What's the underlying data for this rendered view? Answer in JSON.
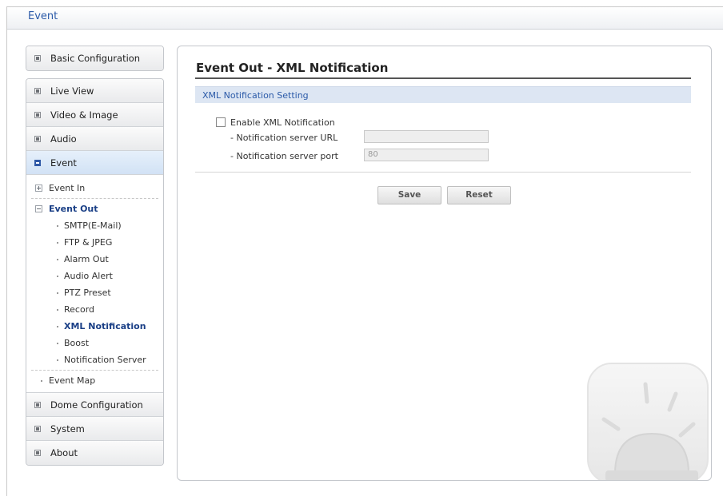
{
  "window": {
    "title": "Event"
  },
  "sidebar": {
    "top_items": [
      {
        "label": "Basic Configuration"
      }
    ],
    "main_items": [
      {
        "label": "Live View"
      },
      {
        "label": "Video & Image"
      },
      {
        "label": "Audio"
      },
      {
        "label": "Event",
        "active": true
      }
    ],
    "event_tree": {
      "event_in": "Event In",
      "event_out": "Event Out",
      "event_out_children": [
        {
          "label": "SMTP(E-Mail)"
        },
        {
          "label": "FTP & JPEG"
        },
        {
          "label": "Alarm Out"
        },
        {
          "label": "Audio Alert"
        },
        {
          "label": "PTZ Preset"
        },
        {
          "label": "Record"
        },
        {
          "label": "XML Notification",
          "selected": true
        },
        {
          "label": "Boost"
        },
        {
          "label": "Notification Server"
        }
      ],
      "event_map": "Event Map"
    },
    "bottom_items": [
      {
        "label": "Dome Configuration"
      },
      {
        "label": "System"
      },
      {
        "label": "About"
      }
    ]
  },
  "main": {
    "title": "Event Out - XML Notification",
    "section_title": "XML Notification Setting",
    "enable_label": "Enable XML Notification",
    "enable_checked": false,
    "url_label": "- Notification server URL",
    "url_value": "",
    "port_label": "- Notification server port",
    "port_placeholder": "80",
    "save_label": "Save",
    "reset_label": "Reset"
  },
  "colors": {
    "accent": "#2b5aa8",
    "section_bar": "#dde6f3",
    "active_nav": "#d2e2f5"
  }
}
